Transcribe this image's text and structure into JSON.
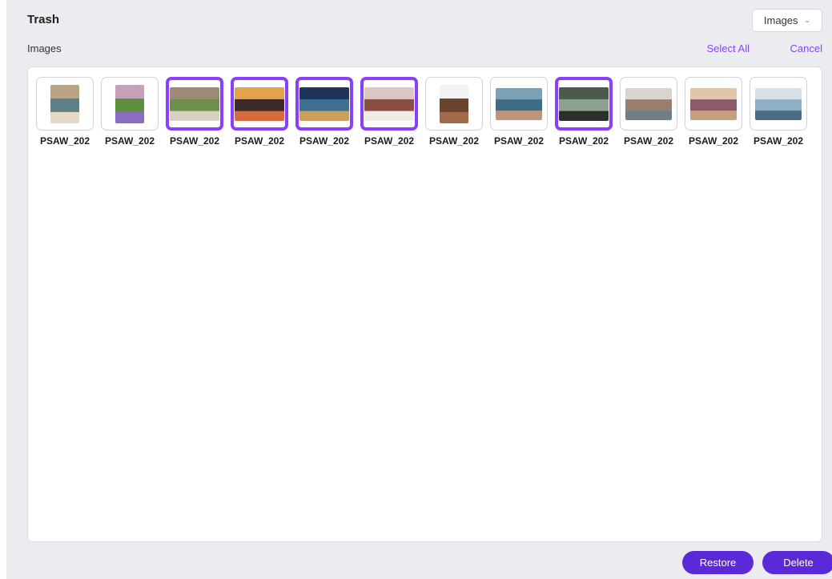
{
  "header": {
    "title": "Trash",
    "filter": {
      "selected": "Images",
      "icon": "chevron-down-icon"
    }
  },
  "toolbar": {
    "section_label": "Images",
    "select_all": "Select All",
    "cancel": "Cancel"
  },
  "items": [
    {
      "name": "PSAW_202",
      "selected": false,
      "orientation": "portrait",
      "colors": [
        "#b7a486",
        "#5d7f86",
        "#e6d8c4"
      ]
    },
    {
      "name": "PSAW_202",
      "selected": false,
      "orientation": "portrait",
      "colors": [
        "#c7a1b8",
        "#5e8f3e",
        "#8c6bc2"
      ]
    },
    {
      "name": "PSAW_202",
      "selected": true,
      "orientation": "land",
      "colors": [
        "#9c8a76",
        "#6e8f4b",
        "#d8d0c2"
      ]
    },
    {
      "name": "PSAW_202",
      "selected": true,
      "orientation": "land",
      "colors": [
        "#e1a34b",
        "#3c2a26",
        "#d66b3e"
      ]
    },
    {
      "name": "PSAW_202",
      "selected": true,
      "orientation": "land",
      "colors": [
        "#1e3458",
        "#3f6f8f",
        "#caa05a"
      ]
    },
    {
      "name": "PSAW_202",
      "selected": true,
      "orientation": "land",
      "colors": [
        "#d9c8c3",
        "#8a4f43",
        "#f1ebe6"
      ]
    },
    {
      "name": "PSAW_202",
      "selected": false,
      "orientation": "portrait",
      "colors": [
        "#f2f2f2",
        "#6b4430",
        "#a16b4b"
      ]
    },
    {
      "name": "PSAW_202",
      "selected": false,
      "orientation": "land",
      "colors": [
        "#7da1b4",
        "#3f6b86",
        "#c19377"
      ]
    },
    {
      "name": "PSAW_202",
      "selected": true,
      "orientation": "land",
      "colors": [
        "#4b5a4a",
        "#8ea08f",
        "#2a2f2a"
      ]
    },
    {
      "name": "PSAW_202",
      "selected": false,
      "orientation": "land",
      "colors": [
        "#d8d4cf",
        "#9a7e6d",
        "#6f7f8a"
      ]
    },
    {
      "name": "PSAW_202",
      "selected": false,
      "orientation": "land",
      "colors": [
        "#e0c7a8",
        "#8e5a6c",
        "#c6a07e"
      ]
    },
    {
      "name": "PSAW_202",
      "selected": false,
      "orientation": "land",
      "colors": [
        "#d6e1e7",
        "#8eb0c7",
        "#4d6b84"
      ]
    }
  ],
  "footer": {
    "restore": "Restore",
    "delete": "Delete"
  },
  "colors": {
    "accent": "#8a3ffc",
    "button": "#5a2ad8",
    "background": "#ebecef"
  }
}
